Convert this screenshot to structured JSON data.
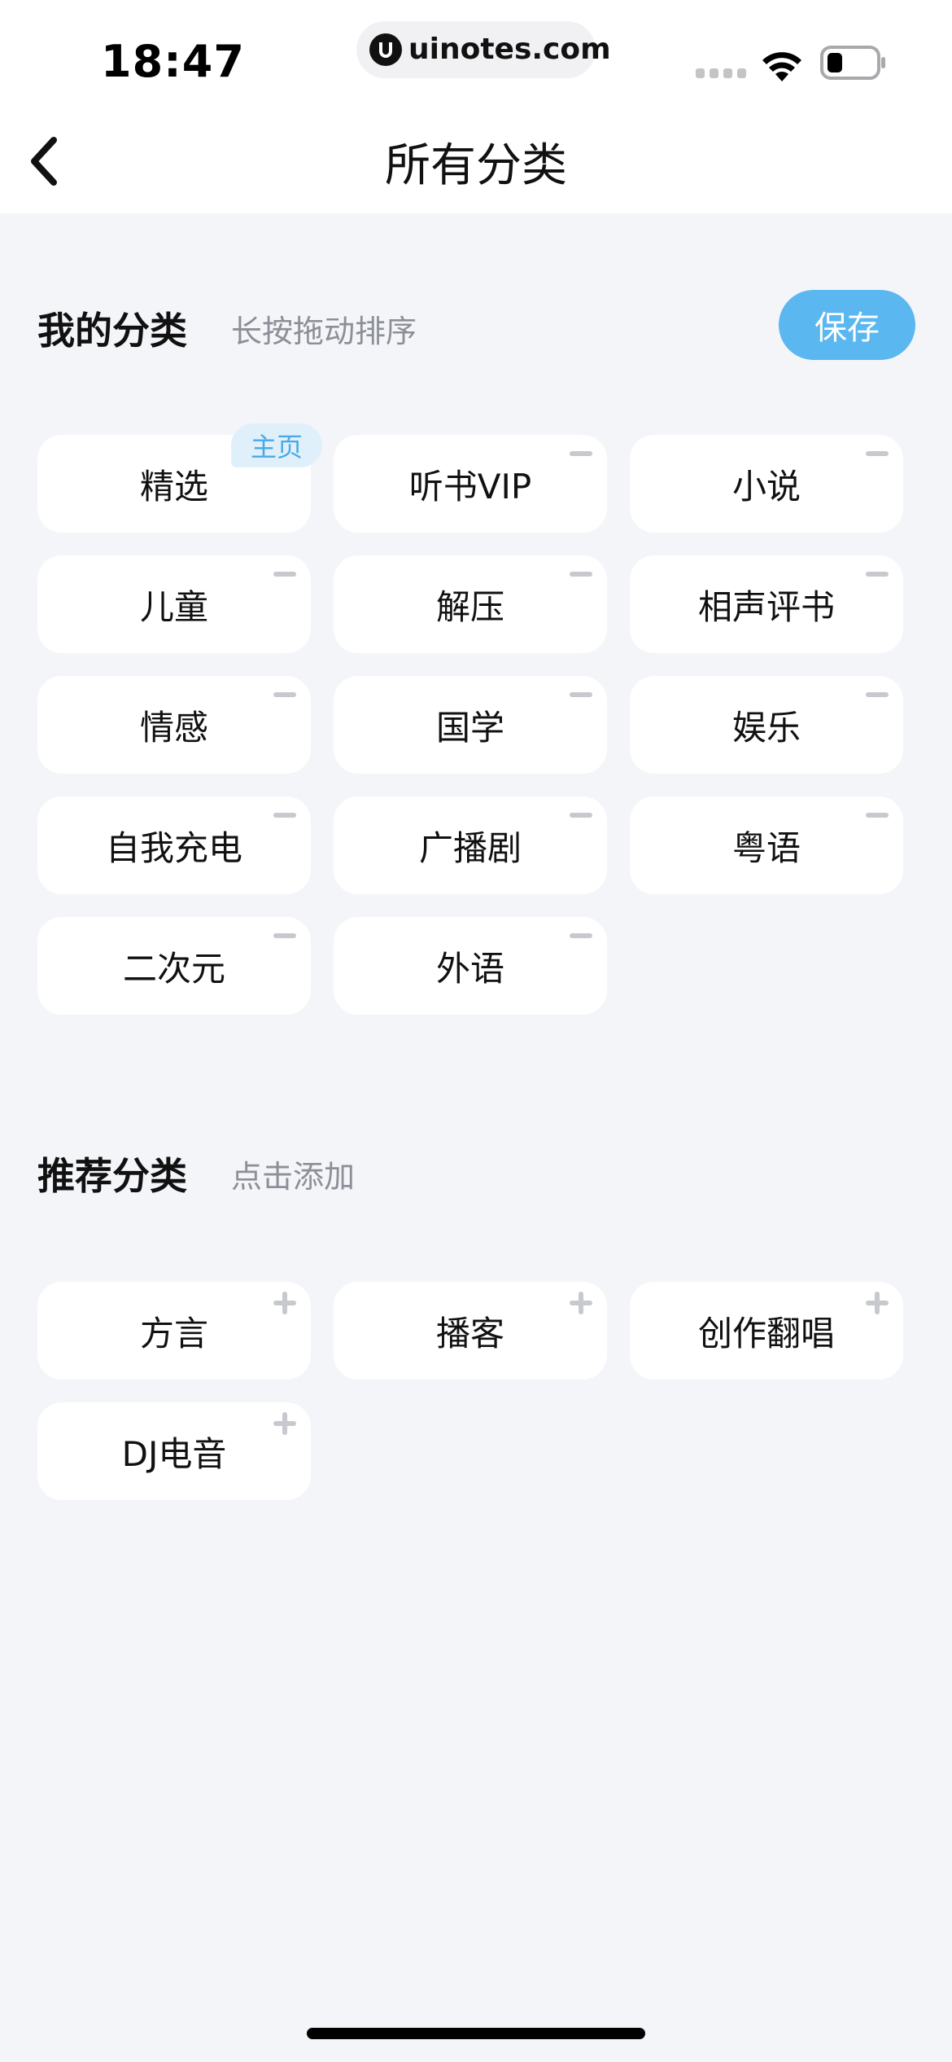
{
  "status_bar": {
    "time": "18:47",
    "url": "uinotes.com"
  },
  "nav": {
    "title": "所有分类"
  },
  "my_categories": {
    "title": "我的分类",
    "hint": "长按拖动排序",
    "save_label": "保存",
    "home_badge": "主页",
    "items": [
      {
        "label": "精选"
      },
      {
        "label": "听书VIP"
      },
      {
        "label": "小说"
      },
      {
        "label": "儿童"
      },
      {
        "label": "解压"
      },
      {
        "label": "相声评书"
      },
      {
        "label": "情感"
      },
      {
        "label": "国学"
      },
      {
        "label": "娱乐"
      },
      {
        "label": "自我充电"
      },
      {
        "label": "广播剧"
      },
      {
        "label": "粤语"
      },
      {
        "label": "二次元"
      },
      {
        "label": "外语"
      }
    ]
  },
  "recommended": {
    "title": "推荐分类",
    "hint": "点击添加",
    "items": [
      {
        "label": "方言"
      },
      {
        "label": "播客"
      },
      {
        "label": "创作翻唱"
      },
      {
        "label": "DJ电音"
      }
    ]
  },
  "colors": {
    "accent": "#5bb7f0",
    "background": "#f4f5f9",
    "tile": "#ffffff",
    "hint_text": "#8c8f97",
    "badge_bg": "#dff0fb",
    "badge_text": "#4aa9e6"
  }
}
